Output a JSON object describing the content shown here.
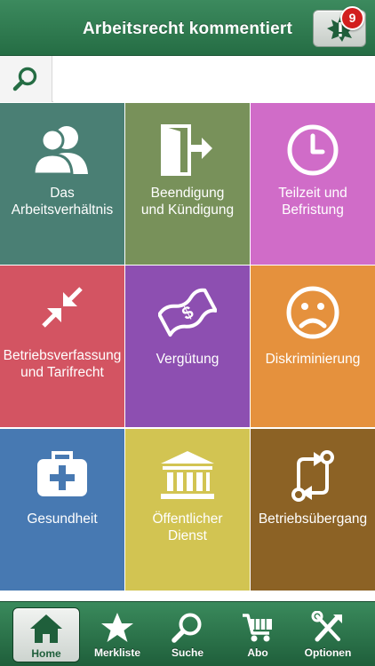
{
  "header": {
    "title": "Arbeitsrecht kommentiert",
    "alert_icon": "alert-starburst-icon",
    "badge_count": "9"
  },
  "search": {
    "icon": "search-icon",
    "value": "",
    "placeholder": ""
  },
  "tiles": [
    {
      "line1": "Das",
      "line2": "Arbeitsverhältnis",
      "color": "#4a7f74",
      "icon": "people-icon"
    },
    {
      "line1": "Beendigung",
      "line2": "und Kündigung",
      "color": "#78915a",
      "icon": "exit-door-icon"
    },
    {
      "line1": "Teilzeit und",
      "line2": "Befristung",
      "color": "#d06cc8",
      "icon": "clock-icon"
    },
    {
      "line1": "Betriebsverfassung",
      "line2": "und Tarifrecht",
      "color": "#d35462",
      "icon": "compress-arrows-icon"
    },
    {
      "line1": "Vergütung",
      "line2": "",
      "color": "#8d4fb1",
      "icon": "money-bill-icon"
    },
    {
      "line1": "Diskriminierung",
      "line2": "",
      "color": "#e5913d",
      "icon": "sad-face-icon"
    },
    {
      "line1": "Gesundheit",
      "line2": "",
      "color": "#4779b2",
      "icon": "medical-kit-icon"
    },
    {
      "line1": "Öffentlicher",
      "line2": "Dienst",
      "color": "#d2c452",
      "icon": "government-building-icon"
    },
    {
      "line1": "Betriebsübergang",
      "line2": "",
      "color": "#8c6225",
      "icon": "transfer-arrows-icon"
    }
  ],
  "tabbar": {
    "items": [
      {
        "label": "Home",
        "icon": "home-icon",
        "active": true
      },
      {
        "label": "Merkliste",
        "icon": "star-icon",
        "active": false
      },
      {
        "label": "Suche",
        "icon": "search-icon",
        "active": false
      },
      {
        "label": "Abo",
        "icon": "cart-icon",
        "active": false
      },
      {
        "label": "Optionen",
        "icon": "tools-icon",
        "active": false
      }
    ]
  }
}
